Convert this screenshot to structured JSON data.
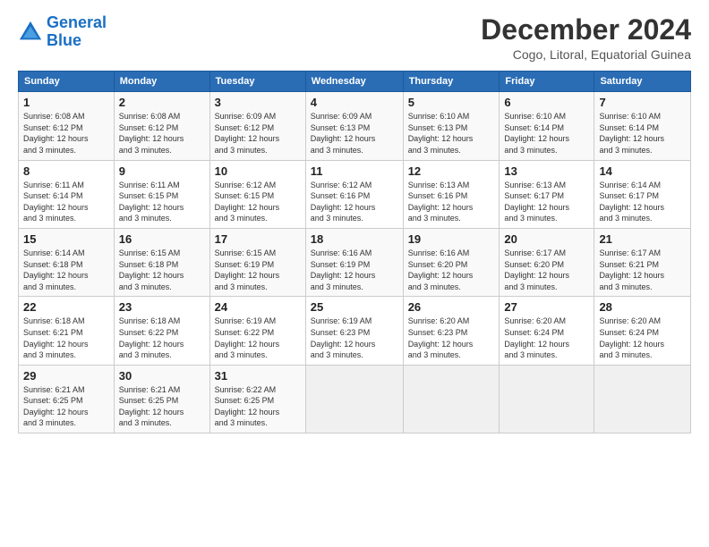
{
  "logo": {
    "line1": "General",
    "line2": "Blue"
  },
  "title": "December 2024",
  "subtitle": "Cogo, Litoral, Equatorial Guinea",
  "days_of_week": [
    "Sunday",
    "Monday",
    "Tuesday",
    "Wednesday",
    "Thursday",
    "Friday",
    "Saturday"
  ],
  "weeks": [
    [
      {
        "day": "1",
        "rise": "6:08 AM",
        "set": "6:12 PM",
        "hours": "12",
        "mins": "3"
      },
      {
        "day": "2",
        "rise": "6:08 AM",
        "set": "6:12 PM",
        "hours": "12",
        "mins": "3"
      },
      {
        "day": "3",
        "rise": "6:09 AM",
        "set": "6:12 PM",
        "hours": "12",
        "mins": "3"
      },
      {
        "day": "4",
        "rise": "6:09 AM",
        "set": "6:13 PM",
        "hours": "12",
        "mins": "3"
      },
      {
        "day": "5",
        "rise": "6:10 AM",
        "set": "6:13 PM",
        "hours": "12",
        "mins": "3"
      },
      {
        "day": "6",
        "rise": "6:10 AM",
        "set": "6:14 PM",
        "hours": "12",
        "mins": "3"
      },
      {
        "day": "7",
        "rise": "6:10 AM",
        "set": "6:14 PM",
        "hours": "12",
        "mins": "3"
      }
    ],
    [
      {
        "day": "8",
        "rise": "6:11 AM",
        "set": "6:14 PM",
        "hours": "12",
        "mins": "3"
      },
      {
        "day": "9",
        "rise": "6:11 AM",
        "set": "6:15 PM",
        "hours": "12",
        "mins": "3"
      },
      {
        "day": "10",
        "rise": "6:12 AM",
        "set": "6:15 PM",
        "hours": "12",
        "mins": "3"
      },
      {
        "day": "11",
        "rise": "6:12 AM",
        "set": "6:16 PM",
        "hours": "12",
        "mins": "3"
      },
      {
        "day": "12",
        "rise": "6:13 AM",
        "set": "6:16 PM",
        "hours": "12",
        "mins": "3"
      },
      {
        "day": "13",
        "rise": "6:13 AM",
        "set": "6:17 PM",
        "hours": "12",
        "mins": "3"
      },
      {
        "day": "14",
        "rise": "6:14 AM",
        "set": "6:17 PM",
        "hours": "12",
        "mins": "3"
      }
    ],
    [
      {
        "day": "15",
        "rise": "6:14 AM",
        "set": "6:18 PM",
        "hours": "12",
        "mins": "3"
      },
      {
        "day": "16",
        "rise": "6:15 AM",
        "set": "6:18 PM",
        "hours": "12",
        "mins": "3"
      },
      {
        "day": "17",
        "rise": "6:15 AM",
        "set": "6:19 PM",
        "hours": "12",
        "mins": "3"
      },
      {
        "day": "18",
        "rise": "6:16 AM",
        "set": "6:19 PM",
        "hours": "12",
        "mins": "3"
      },
      {
        "day": "19",
        "rise": "6:16 AM",
        "set": "6:20 PM",
        "hours": "12",
        "mins": "3"
      },
      {
        "day": "20",
        "rise": "6:17 AM",
        "set": "6:20 PM",
        "hours": "12",
        "mins": "3"
      },
      {
        "day": "21",
        "rise": "6:17 AM",
        "set": "6:21 PM",
        "hours": "12",
        "mins": "3"
      }
    ],
    [
      {
        "day": "22",
        "rise": "6:18 AM",
        "set": "6:21 PM",
        "hours": "12",
        "mins": "3"
      },
      {
        "day": "23",
        "rise": "6:18 AM",
        "set": "6:22 PM",
        "hours": "12",
        "mins": "3"
      },
      {
        "day": "24",
        "rise": "6:19 AM",
        "set": "6:22 PM",
        "hours": "12",
        "mins": "3"
      },
      {
        "day": "25",
        "rise": "6:19 AM",
        "set": "6:23 PM",
        "hours": "12",
        "mins": "3"
      },
      {
        "day": "26",
        "rise": "6:20 AM",
        "set": "6:23 PM",
        "hours": "12",
        "mins": "3"
      },
      {
        "day": "27",
        "rise": "6:20 AM",
        "set": "6:24 PM",
        "hours": "12",
        "mins": "3"
      },
      {
        "day": "28",
        "rise": "6:20 AM",
        "set": "6:24 PM",
        "hours": "12",
        "mins": "3"
      }
    ],
    [
      {
        "day": "29",
        "rise": "6:21 AM",
        "set": "6:25 PM",
        "hours": "12",
        "mins": "3"
      },
      {
        "day": "30",
        "rise": "6:21 AM",
        "set": "6:25 PM",
        "hours": "12",
        "mins": "3"
      },
      {
        "day": "31",
        "rise": "6:22 AM",
        "set": "6:25 PM",
        "hours": "12",
        "mins": "3"
      },
      null,
      null,
      null,
      null
    ]
  ]
}
